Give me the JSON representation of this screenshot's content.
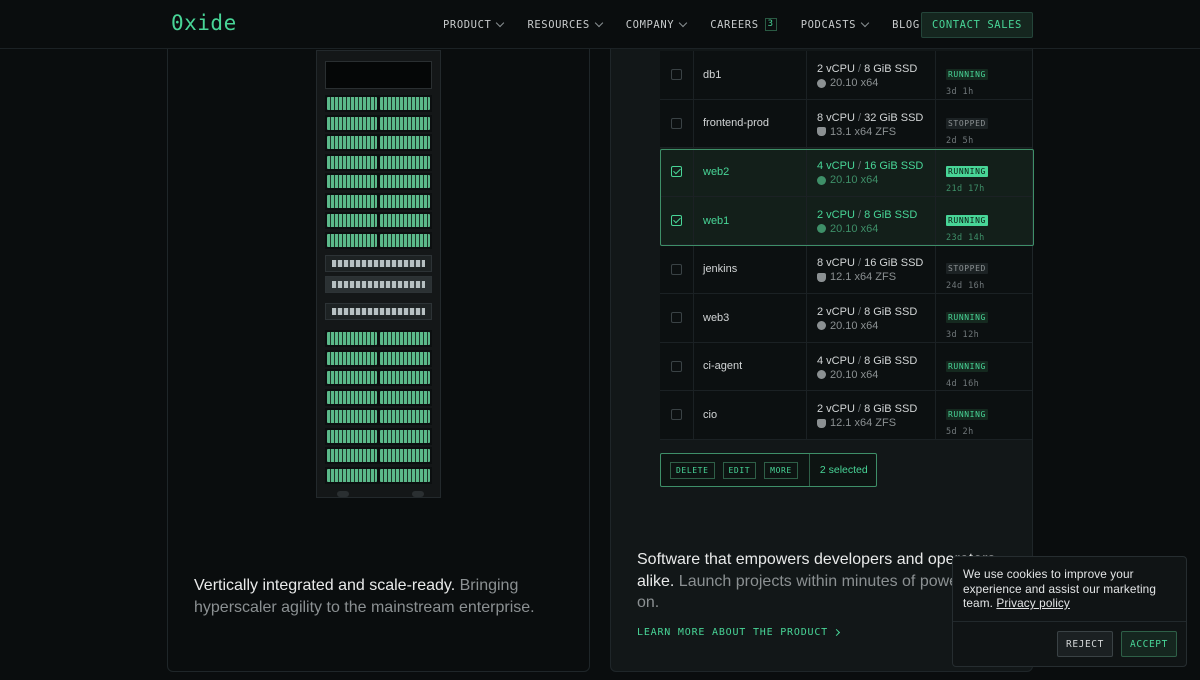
{
  "header": {
    "logo": "0xide",
    "nav": [
      {
        "label": "PRODUCT",
        "dropdown": true
      },
      {
        "label": "RESOURCES",
        "dropdown": true
      },
      {
        "label": "COMPANY",
        "dropdown": true
      },
      {
        "label": "CAREERS",
        "badge": "3"
      },
      {
        "label": "PODCASTS",
        "dropdown": true
      },
      {
        "label": "BLOG"
      }
    ],
    "contact_label": "CONTACT SALES"
  },
  "left_card": {
    "headline": "Vertically integrated and scale-ready.",
    "body": " Bringing hyperscaler agility to the mainstream enterprise."
  },
  "instances": [
    {
      "name": "db1",
      "cpu": "2 vCPU",
      "mem": "8 GiB SSD",
      "os": "20.10 x64",
      "os_icon": "ubuntu-icon",
      "state": "RUNNING",
      "uptime": "3d 1h",
      "selected": false
    },
    {
      "name": "frontend-prod",
      "cpu": "8 vCPU",
      "mem": "32 GiB SSD",
      "os": "13.1 x64 ZFS",
      "os_icon": "freebsd-icon",
      "state": "STOPPED",
      "uptime": "2d 5h",
      "selected": false
    },
    {
      "name": "web2",
      "cpu": "4 vCPU",
      "mem": "16 GiB SSD",
      "os": "20.10 x64",
      "os_icon": "ubuntu-icon",
      "state": "RUNNING",
      "uptime": "21d 17h",
      "selected": true
    },
    {
      "name": "web1",
      "cpu": "2 vCPU",
      "mem": "8 GiB SSD",
      "os": "20.10 x64",
      "os_icon": "ubuntu-icon",
      "state": "RUNNING",
      "uptime": "23d 14h",
      "selected": true
    },
    {
      "name": "jenkins",
      "cpu": "8 vCPU",
      "mem": "16 GiB SSD",
      "os": "12.1 x64 ZFS",
      "os_icon": "freebsd-icon",
      "state": "STOPPED",
      "uptime": "24d 16h",
      "selected": false
    },
    {
      "name": "web3",
      "cpu": "2 vCPU",
      "mem": "8 GiB SSD",
      "os": "20.10 x64",
      "os_icon": "ubuntu-icon",
      "state": "RUNNING",
      "uptime": "3d 12h",
      "selected": false
    },
    {
      "name": "ci-agent",
      "cpu": "4 vCPU",
      "mem": "8 GiB SSD",
      "os": "20.10 x64",
      "os_icon": "ubuntu-icon",
      "state": "RUNNING",
      "uptime": "4d 16h",
      "selected": false
    },
    {
      "name": "cio",
      "cpu": "2 vCPU",
      "mem": "8 GiB SSD",
      "os": "12.1 x64 ZFS",
      "os_icon": "freebsd-icon",
      "state": "RUNNING",
      "uptime": "5d 2h",
      "selected": false
    }
  ],
  "actions": {
    "delete": "DELETE",
    "edit": "EDIT",
    "more": "MORE",
    "selected_count": "2 selected"
  },
  "right_card": {
    "headline": "Software that empowers developers and operators alike.",
    "body": " Launch projects within minutes of powering on.",
    "link": "LEARN MORE ABOUT THE PRODUCT"
  },
  "cookie": {
    "text": "We use cookies to improve your experience and assist our marketing team.",
    "link": "Privacy policy",
    "reject": "REJECT",
    "accept": "ACCEPT"
  },
  "colors": {
    "accent": "#48d597",
    "background": "#0a0d0e",
    "card": "#121718"
  }
}
